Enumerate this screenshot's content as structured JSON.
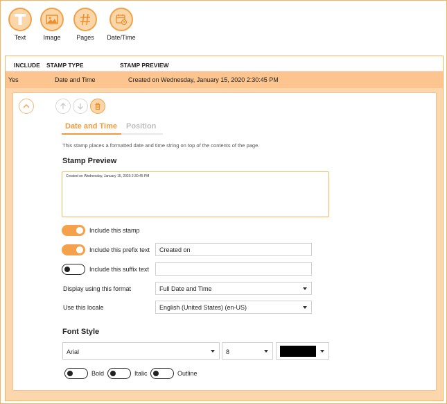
{
  "toolbar": {
    "items": [
      {
        "label": "Text",
        "icon": "text-icon"
      },
      {
        "label": "Image",
        "icon": "image-icon"
      },
      {
        "label": "Pages",
        "icon": "hash-icon"
      },
      {
        "label": "Date/Time",
        "icon": "calendar-clock-icon"
      }
    ]
  },
  "table": {
    "headers": {
      "include": "INCLUDE",
      "stamp_type": "STAMP TYPE",
      "stamp_preview": "STAMP PREVIEW"
    },
    "row": {
      "include": "Yes",
      "stamp_type": "Date and Time",
      "stamp_preview": "Created on Wednesday, January 15, 2020 2:30:45 PM"
    }
  },
  "editor": {
    "tabs": {
      "active": "Date and Time",
      "inactive": "Position"
    },
    "description": "This stamp places a formatted date and time string on top of the contents of the page.",
    "stamp_preview_heading": "Stamp Preview",
    "stamp_preview_text": "Created on Wednesday, January 15, 2020 2:30:45 PM",
    "include_stamp_label": "Include this stamp",
    "include_stamp_on": true,
    "prefix_label": "Include this prefix text",
    "prefix_on": true,
    "prefix_value": "Created on",
    "suffix_label": "Include this suffix text",
    "suffix_on": false,
    "suffix_value": "",
    "format_label": "Display using this format",
    "format_value": "Full Date and Time",
    "locale_label": "Use this locale",
    "locale_value": "English (United States) (en-US)",
    "font_style_heading": "Font Style",
    "font_family": "Arial",
    "font_size": "8",
    "font_color": "#000000",
    "bold_label": "Bold",
    "italic_label": "Italic",
    "outline_label": "Outline"
  },
  "colors": {
    "accent": "#f29a3a",
    "accent_light": "#fbd6a8",
    "row_selected": "#fcc48e"
  }
}
